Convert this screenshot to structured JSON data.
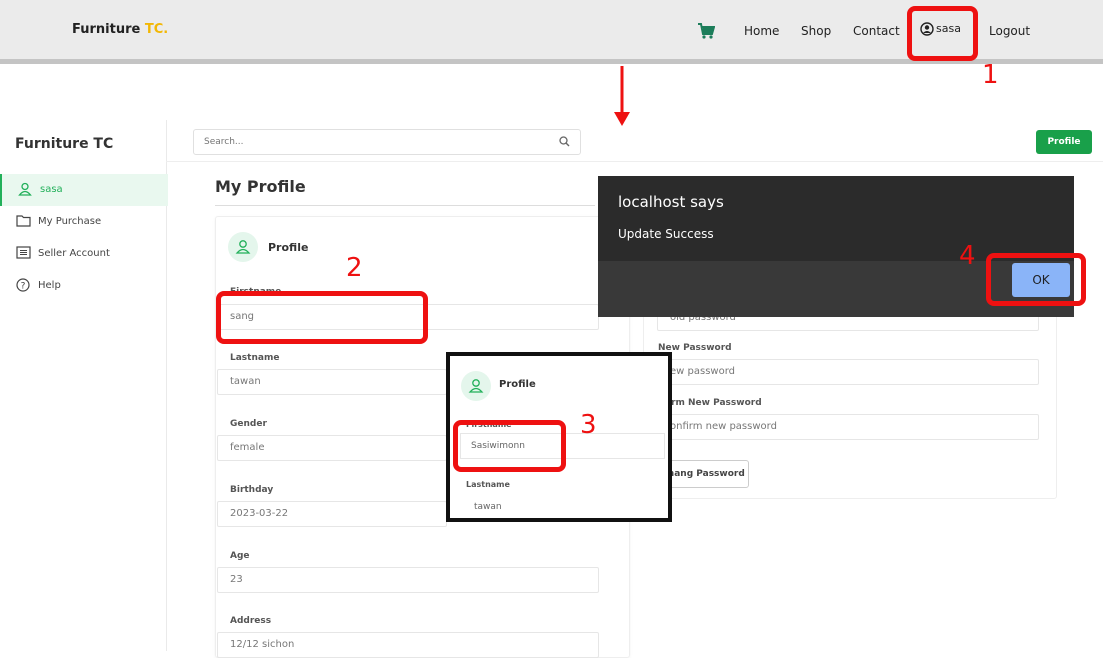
{
  "top_nav": {
    "brand": "Furniture",
    "brand_accent": "TC.",
    "links": [
      "Home",
      "Shop",
      "Contact"
    ],
    "user": "sasa",
    "logout": "Logout"
  },
  "sidebar": {
    "brand": "Furniture TC",
    "items": [
      {
        "label": "sasa",
        "icon": "user-icon"
      },
      {
        "label": "My Purchase",
        "icon": "folder-icon"
      },
      {
        "label": "Seller Account",
        "icon": "list-icon"
      },
      {
        "label": "Help",
        "icon": "help-circle-icon"
      }
    ]
  },
  "header": {
    "search_placeholder": "Search...",
    "profile_button": "Profile"
  },
  "profile": {
    "page_title": "My Profile",
    "card_title": "Profile",
    "fields": {
      "firstname_label": "Firstname",
      "firstname": "sang",
      "lastname_label": "Lastname",
      "lastname": "tawan",
      "gender_label": "Gender",
      "gender": "female",
      "birthday_label": "Birthday",
      "birthday": "2023-03-22",
      "age_label": "Age",
      "age": "23",
      "address_label": "Address",
      "address": "12/12 sichon"
    }
  },
  "password": {
    "old_placeholder": "old password",
    "new_label": "New Password",
    "new_placeholder": "ew password",
    "confirm_label": "nfirm New Password",
    "confirm_placeholder": "onfirm new password",
    "button": "Chang Password"
  },
  "inset": {
    "card_title": "Profile",
    "firstname_label": "Firstname",
    "firstname": "Sasiwimonn",
    "lastname_label": "Lastname",
    "lastname": "tawan"
  },
  "alert": {
    "title": "localhost says",
    "message": "Update Success",
    "ok": "OK"
  },
  "annotations": {
    "n1": "1",
    "n2": "2",
    "n3": "3",
    "n4": "4"
  },
  "colors": {
    "accent_green": "#19a04a",
    "annotation_red": "#ee1111",
    "brand_accent": "#f2b705"
  }
}
